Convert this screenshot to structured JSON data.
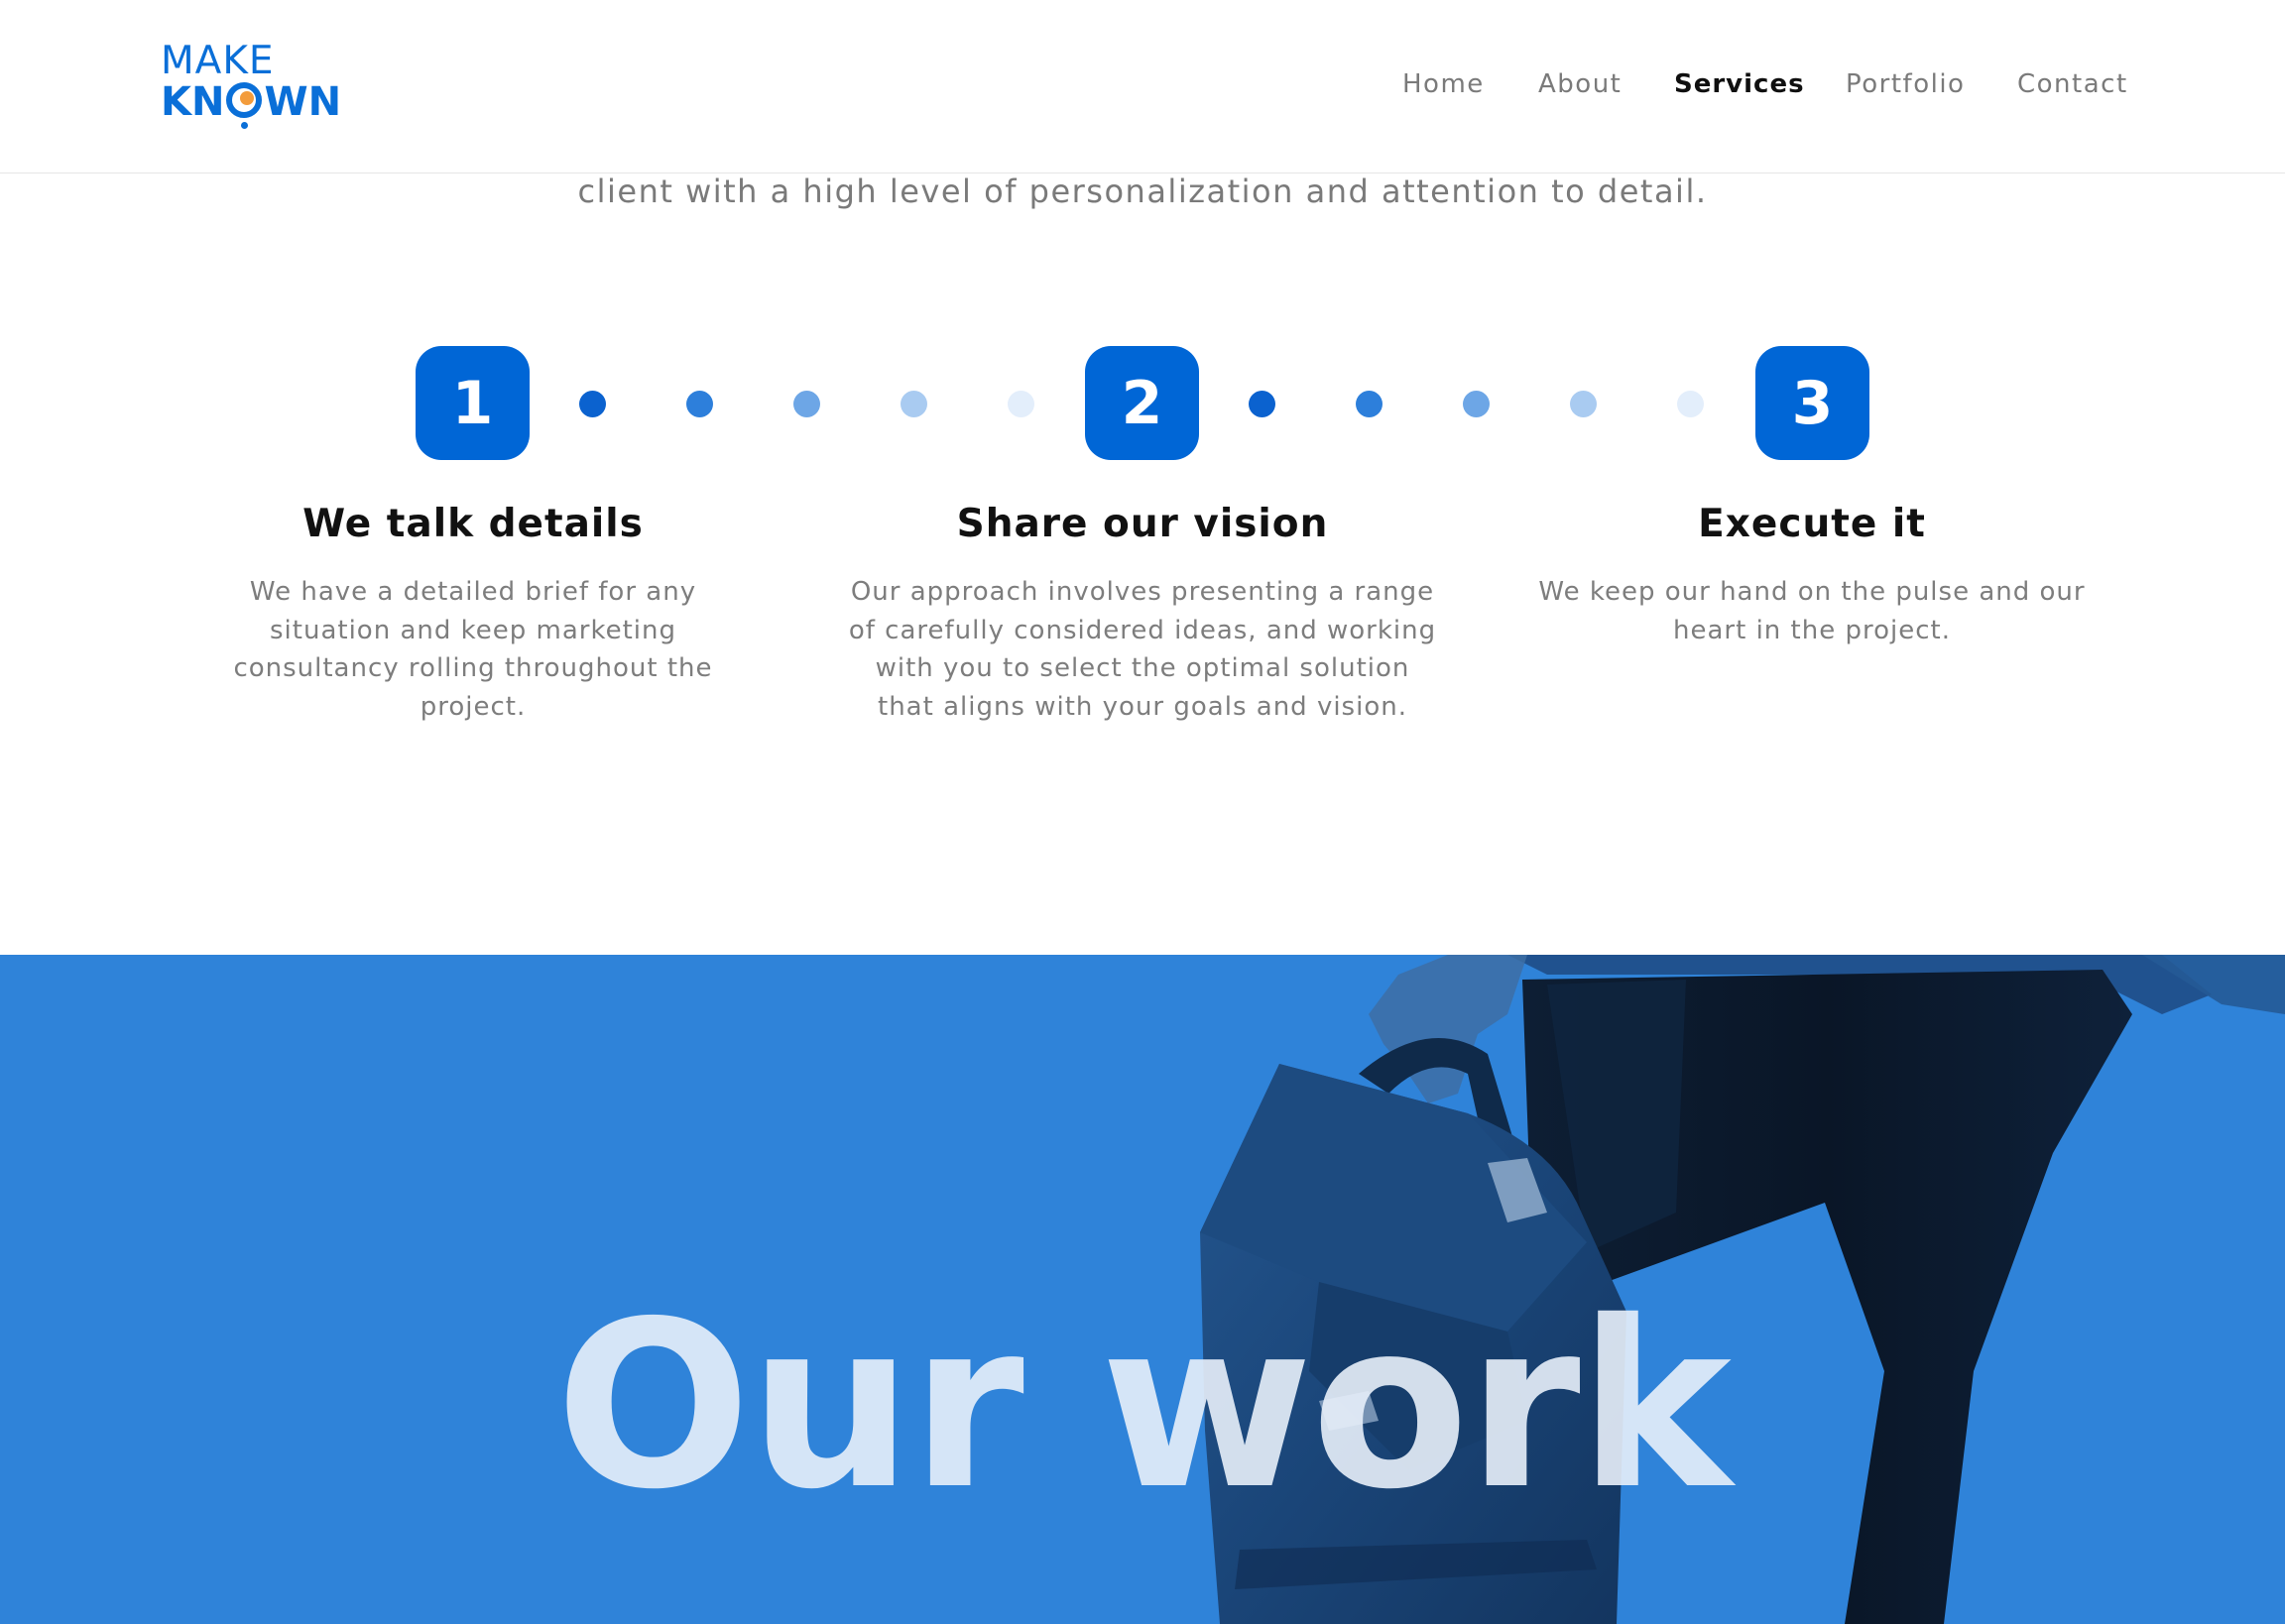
{
  "brand": {
    "line1": "MAKE",
    "line2_prefix": "KN",
    "line2_suffix": "WN",
    "primary_color": "#0a6fd8",
    "accent_color": "#f39c3c"
  },
  "nav": {
    "items": [
      {
        "label": "Home",
        "active": false
      },
      {
        "label": "About",
        "active": false
      },
      {
        "label": "Services",
        "active": true
      },
      {
        "label": "Portfolio",
        "active": false
      },
      {
        "label": "Contact",
        "active": false
      }
    ]
  },
  "intro": {
    "text": "client with a high level of personalization and attention to detail."
  },
  "process": {
    "badge_color": "#0066d6",
    "steps": [
      {
        "number": "1",
        "title": "We talk details",
        "description": "We have a detailed brief for any situation and keep marketing consultancy rolling throughout the project."
      },
      {
        "number": "2",
        "title": "Share our vision",
        "description": "Our approach involves presenting a range of carefully considered ideas, and working with you to select the optimal solution that aligns with your goals and vision."
      },
      {
        "number": "3",
        "title": "Execute it",
        "description": "We keep our hand on the pulse and our heart in the project."
      }
    ]
  },
  "work": {
    "title": "Our work",
    "background_color": "#2f83d9"
  }
}
